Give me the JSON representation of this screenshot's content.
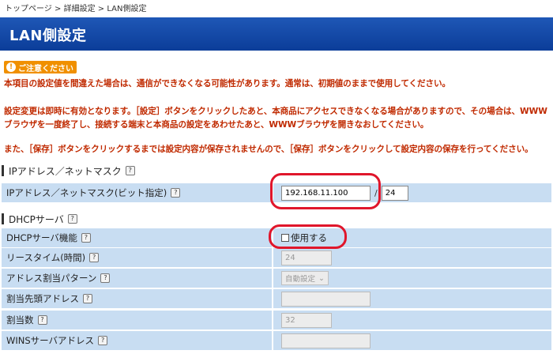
{
  "breadcrumb": {
    "top": "トップページ",
    "sep": ">",
    "detail": "詳細設定",
    "current": "LAN側設定"
  },
  "page_title": "LAN側設定",
  "caution": {
    "label": "ご注意ください",
    "icon": "exclamation-icon"
  },
  "notes": [
    "本項目の設定値を間違えた場合は、通信ができなくなる可能性があります。通常は、初期値のままで使用してください。",
    "設定変更は即時に有効となります。［設定］ボタンをクリックしたあと、本商品にアクセスできなくなる場合がありますので、その場合は、WWW",
    "ブラウザを一度終了し、接続する端末と本商品の設定をあわせたあと、WWWブラウザを開きなおしてください。",
    "また、［保存］ボタンをクリックするまでは設定内容が保存されませんので、［保存］ボタンをクリックして設定内容の保存を行ってください。"
  ],
  "help_label": "?",
  "ip_section": {
    "title": "IPアドレス／ネットマスク",
    "label": "IPアドレス／ネットマスク(ビット指定)",
    "ip_value": "192.168.11.100",
    "mask_sep": "/",
    "mask_value": "24"
  },
  "dhcp_section": {
    "title": "DHCPサーバ",
    "rows": {
      "function": {
        "label": "DHCPサーバ機能",
        "checkbox_label": "使用する",
        "checked": false
      },
      "lease": {
        "label": "リースタイム(時間)",
        "value": "24"
      },
      "pattern": {
        "label": "アドレス割当パターン",
        "value": "自動設定"
      },
      "start": {
        "label": "割当先頭アドレス",
        "value": ""
      },
      "count": {
        "label": "割当数",
        "value": "32"
      },
      "wins": {
        "label": "WINSサーバアドレス",
        "value": ""
      }
    }
  },
  "colors": {
    "title_bg": "#1548a8",
    "caution_bg": "#f09000",
    "note_text": "#c02a00",
    "row_bg": "#c8ddf2",
    "highlight": "#e0162b"
  }
}
